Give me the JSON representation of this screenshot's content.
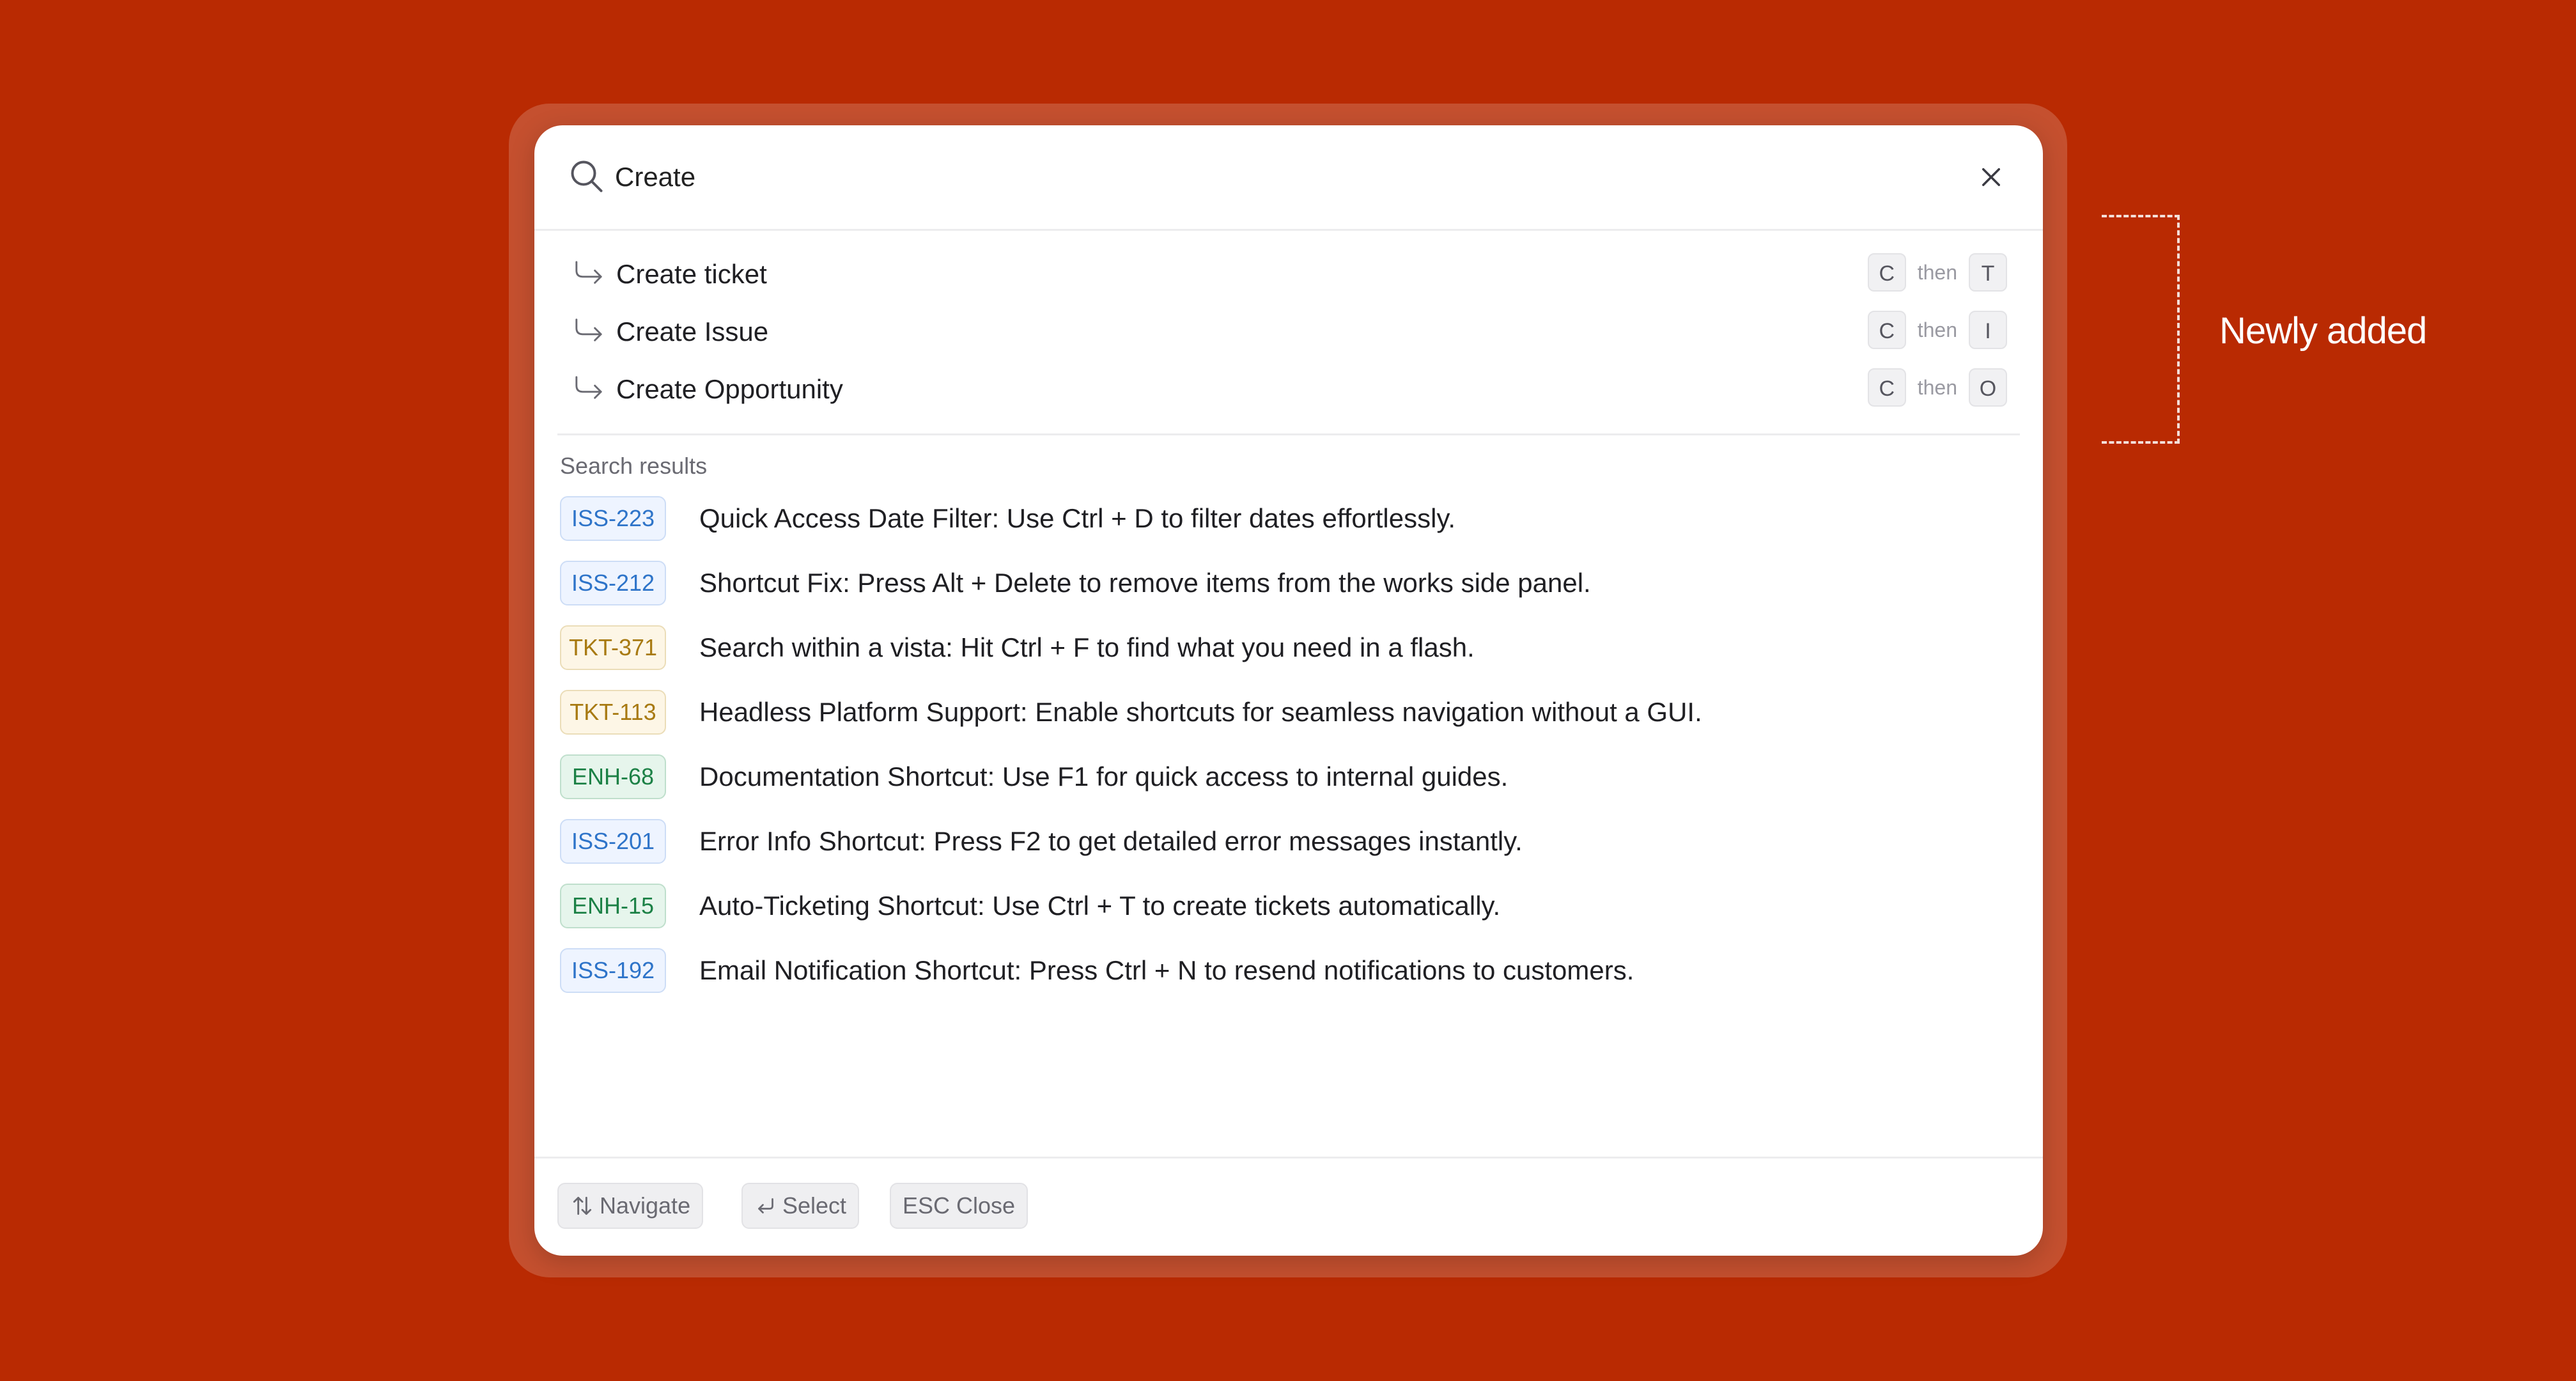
{
  "search": {
    "value": "Create"
  },
  "commands": [
    {
      "label": "Create ticket",
      "keys": [
        "C",
        "T"
      ],
      "then": "then"
    },
    {
      "label": "Create Issue",
      "keys": [
        "C",
        "I"
      ],
      "then": "then"
    },
    {
      "label": "Create Opportunity",
      "keys": [
        "C",
        "O"
      ],
      "then": "then"
    }
  ],
  "results_section": {
    "title": "Search results"
  },
  "results": [
    {
      "id": "ISS-223",
      "kind": "iss",
      "text": "Quick Access Date Filter: Use Ctrl + D to filter dates effortlessly."
    },
    {
      "id": "ISS-212",
      "kind": "iss",
      "text": "Shortcut Fix: Press Alt + Delete to remove items from the works side panel."
    },
    {
      "id": "TKT-371",
      "kind": "tkt",
      "text": "Search within a vista: Hit Ctrl + F to find what you need in a flash."
    },
    {
      "id": "TKT-113",
      "kind": "tkt",
      "text": "Headless Platform Support: Enable shortcuts for seamless navigation without a GUI."
    },
    {
      "id": "ENH-68",
      "kind": "enh",
      "text": "Documentation Shortcut: Use F1 for quick access to internal guides."
    },
    {
      "id": "ISS-201",
      "kind": "iss",
      "text": "Error Info Shortcut: Press F2 to get detailed error messages instantly."
    },
    {
      "id": "ENH-15",
      "kind": "enh",
      "text": "Auto-Ticketing Shortcut: Use Ctrl + T to create tickets automatically."
    },
    {
      "id": "ISS-192",
      "kind": "iss",
      "text": "Email Notification Shortcut: Press Ctrl + N to resend notifications to customers."
    }
  ],
  "footer": {
    "navigate_label": "Navigate",
    "select_label": "Select",
    "close_label": "ESC Close"
  },
  "annotation": {
    "label": "Newly added"
  },
  "colors": {
    "background": "#B92A02",
    "iss_badge": "#2E74C9",
    "tkt_badge": "#A87A12",
    "enh_badge": "#1C8146"
  }
}
